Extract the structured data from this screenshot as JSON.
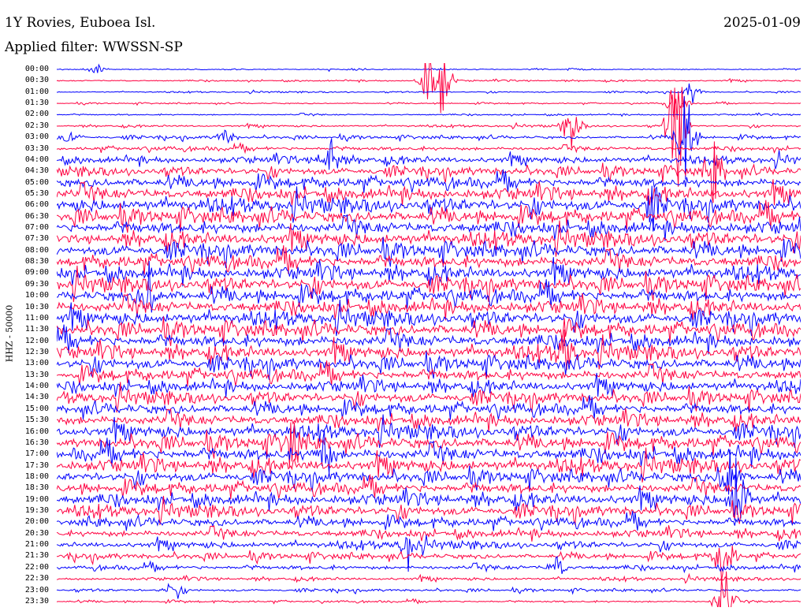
{
  "header": {
    "station": "1Y Rovies, Euboea Isl.",
    "date": "2025-01-09",
    "filter": "Applied filter: WWSSN-SP"
  },
  "colors": {
    "trace_a": "#0000ff",
    "trace_b": "#ff0040",
    "background": "#ffffff",
    "text": "#000000"
  },
  "chart_data": {
    "type": "line",
    "chart_kind": "helicorder",
    "ylabel": "HHZ - 50000",
    "x": {
      "range_minutes": [
        0,
        30
      ]
    },
    "rows": [
      "00:00",
      "00:30",
      "01:00",
      "01:30",
      "02:00",
      "02:30",
      "03:00",
      "03:30",
      "04:00",
      "04:30",
      "05:00",
      "05:30",
      "06:00",
      "06:30",
      "07:00",
      "07:30",
      "08:00",
      "08:30",
      "09:00",
      "09:30",
      "10:00",
      "10:30",
      "11:00",
      "11:30",
      "12:00",
      "12:30",
      "13:00",
      "13:30",
      "14:00",
      "14:30",
      "15:00",
      "15:30",
      "16:00",
      "16:30",
      "17:00",
      "17:30",
      "18:00",
      "18:30",
      "19:00",
      "19:30",
      "20:00",
      "20:30",
      "21:00",
      "21:30",
      "22:00",
      "22:30",
      "23:00",
      "23:30"
    ],
    "series_colors_alternate": [
      "blue",
      "red"
    ],
    "noise_level_per_row": [
      0.5,
      0.6,
      0.5,
      0.5,
      0.6,
      0.8,
      1.2,
      1.6,
      2.6,
      3.2,
      4.0,
      4.6,
      5.0,
      5.0,
      5.0,
      5.0,
      5.0,
      5.0,
      5.0,
      5.0,
      5.0,
      5.0,
      5.0,
      5.0,
      5.0,
      4.8,
      4.6,
      4.4,
      4.2,
      4.2,
      4.2,
      4.4,
      4.6,
      4.8,
      5.0,
      4.8,
      4.2,
      4.2,
      4.4,
      4.0,
      3.4,
      3.0,
      2.6,
      2.2,
      1.8,
      1.2,
      1.0,
      0.8
    ],
    "events": [
      {
        "row": "00:00",
        "x_minutes": 1.6,
        "amplitude": 8
      },
      {
        "row": "00:30",
        "x_minutes": 15.0,
        "amplitude": 40
      },
      {
        "row": "00:30",
        "x_minutes": 15.6,
        "amplitude": 30
      },
      {
        "row": "01:00",
        "x_minutes": 25.6,
        "amplitude": 12
      },
      {
        "row": "01:30",
        "x_minutes": 25.0,
        "amplitude": 30
      },
      {
        "row": "02:30",
        "x_minutes": 20.8,
        "amplitude": 30
      },
      {
        "row": "02:30",
        "x_minutes": 25.0,
        "amplitude": 120
      },
      {
        "row": "03:00",
        "x_minutes": 25.4,
        "amplitude": 80
      },
      {
        "row": "03:00",
        "x_minutes": 0.5,
        "amplitude": 12
      },
      {
        "row": "03:00",
        "x_minutes": 6.8,
        "amplitude": 10
      },
      {
        "row": "04:00",
        "x_minutes": 11.0,
        "amplitude": 30
      },
      {
        "row": "04:30",
        "x_minutes": 26.5,
        "amplitude": 40
      },
      {
        "row": "06:00",
        "x_minutes": 24.0,
        "amplitude": 25
      },
      {
        "row": "10:00",
        "x_minutes": 3.7,
        "amplitude": 30
      },
      {
        "row": "12:30",
        "x_minutes": 20.5,
        "amplitude": 30
      },
      {
        "row": "16:30",
        "x_minutes": 9.5,
        "amplitude": 35
      },
      {
        "row": "17:00",
        "x_minutes": 10.8,
        "amplitude": 30
      },
      {
        "row": "18:00",
        "x_minutes": 27.1,
        "amplitude": 50
      },
      {
        "row": "19:00",
        "x_minutes": 27.5,
        "amplitude": 60
      },
      {
        "row": "21:00",
        "x_minutes": 14.2,
        "amplitude": 20
      },
      {
        "row": "21:30",
        "x_minutes": 26.9,
        "amplitude": 50
      },
      {
        "row": "22:00",
        "x_minutes": 20.2,
        "amplitude": 14
      },
      {
        "row": "23:00",
        "x_minutes": 4.7,
        "amplitude": 12
      },
      {
        "row": "23:30",
        "x_minutes": 26.9,
        "amplitude": 40
      }
    ]
  }
}
